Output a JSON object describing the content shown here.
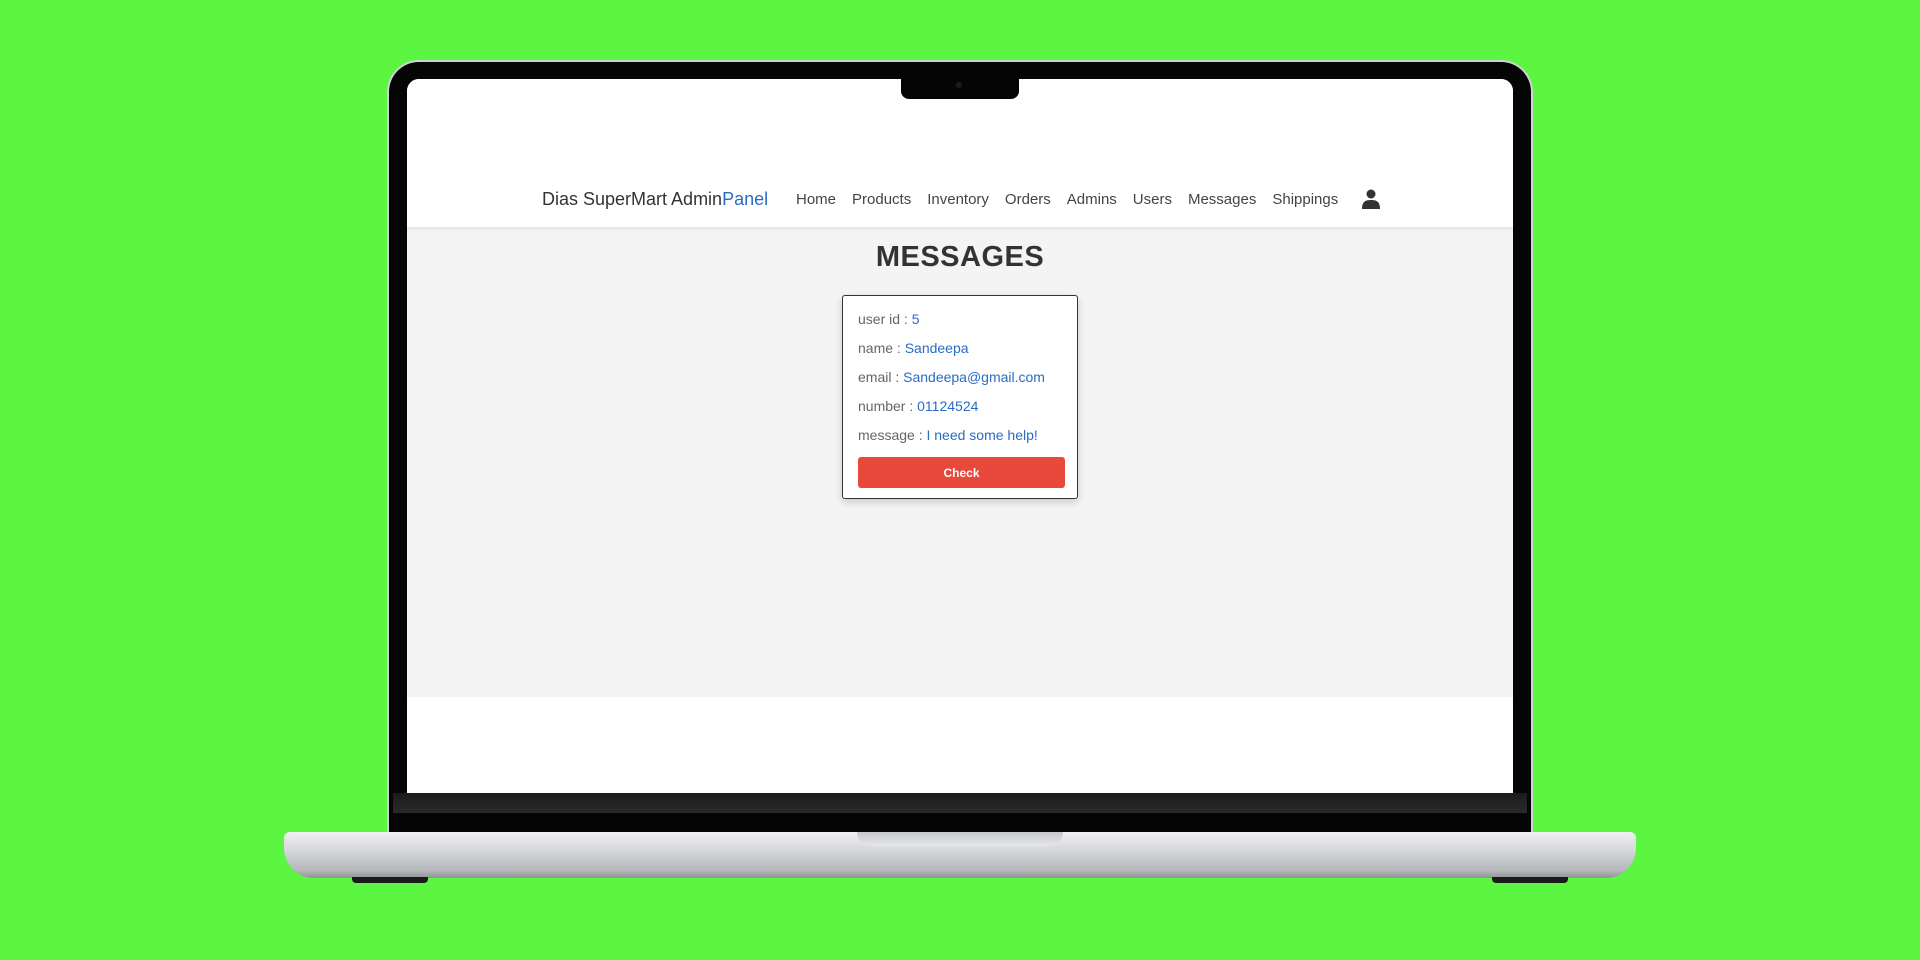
{
  "navbar": {
    "brand_main": "Dias SuperMart Admin",
    "brand_accent": "Panel",
    "links": [
      "Home",
      "Products",
      "Inventory",
      "Orders",
      "Admins",
      "Users",
      "Messages",
      "Shippings"
    ],
    "user_icon": "user-icon"
  },
  "page": {
    "title": "MESSAGES"
  },
  "message": {
    "user_id_label": "user id : ",
    "user_id": "5",
    "name_label": "name : ",
    "name": "Sandeepa",
    "email_label": "email : ",
    "email": "Sandeepa@gmail.com",
    "number_label": "number : ",
    "number": "01124524",
    "message_label": "message : ",
    "message": "I need some help!",
    "check_label": "Check"
  },
  "colors": {
    "background": "#5cf542",
    "accent": "#2a6cc4",
    "button": "#e8493b",
    "content_bg": "#f4f4f4"
  }
}
